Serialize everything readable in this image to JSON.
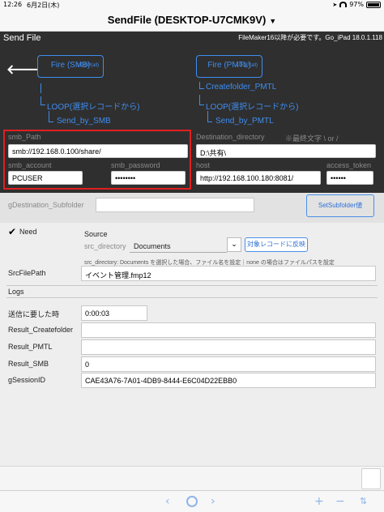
{
  "status": {
    "time": "12:26",
    "date": "6月2日(木)",
    "battery": "97%"
  },
  "window": {
    "title": "SendFile (DESKTOP-U7CMK9V)"
  },
  "header": {
    "title": "Send File",
    "requirement": "FileMaker16以降が必要です。Go_iPad 18.0.1.118"
  },
  "left_script": {
    "fire_label": "Fire (SMB)",
    "loop_badge": "LOOP(all)",
    "loop_link": "LOOP(選択レコードから)",
    "send_link": "Send_by_SMB"
  },
  "right_script": {
    "fire_label": "Fire (PMTL)",
    "loop_badge": "LOOP(all)",
    "create_link": "Createfolder_PMTL",
    "loop_link": "LOOP(選択レコードから)",
    "send_link": "Send_by_PMTL"
  },
  "smb": {
    "path_label": "smb_Path",
    "path_value": "smb://192.168.0.100/share/",
    "account_label": "smb_account",
    "account_value": "PCUSER",
    "password_label": "smb_password",
    "password_value": "••••••••"
  },
  "pmtl": {
    "dest_label": "Destination_directory",
    "dest_note": "※最終文字 \\ or /",
    "dest_value": "D:\\共有\\",
    "host_label": "host",
    "host_value": "http://192.168.100.180:8081/",
    "token_label": "access_token",
    "token_value": "••••••"
  },
  "subfolder": {
    "label": "gDestination_Subfolder",
    "value": "",
    "button": "SetSubfolder値"
  },
  "form": {
    "need_label": "Need",
    "source_label": "Source",
    "src_dir_label": "src_directory",
    "src_dir_value": "Documents",
    "reflect_button": "対象レコードに反映",
    "note": "src_directory: Documents を選択した場合、ファイル名を設定｜none の場合はファイルパスを設定",
    "srcfilepath_label": "SrcFilePath",
    "srcfilepath_value": "イベント管理.fmp12",
    "logs_label": "Logs",
    "elapsed_label": "送信に要した時",
    "elapsed_value": "0:00:03",
    "createfolder_label": "Result_Createfolder",
    "createfolder_value": "",
    "pmtl_label": "Result_PMTL",
    "pmtl_value": "",
    "smb_label": "Result_SMB",
    "smb_value": "0",
    "session_label": "gSessionID",
    "session_value": "CAE43A76-7A01-4DB9-8444-E6C04D22EBB0"
  }
}
